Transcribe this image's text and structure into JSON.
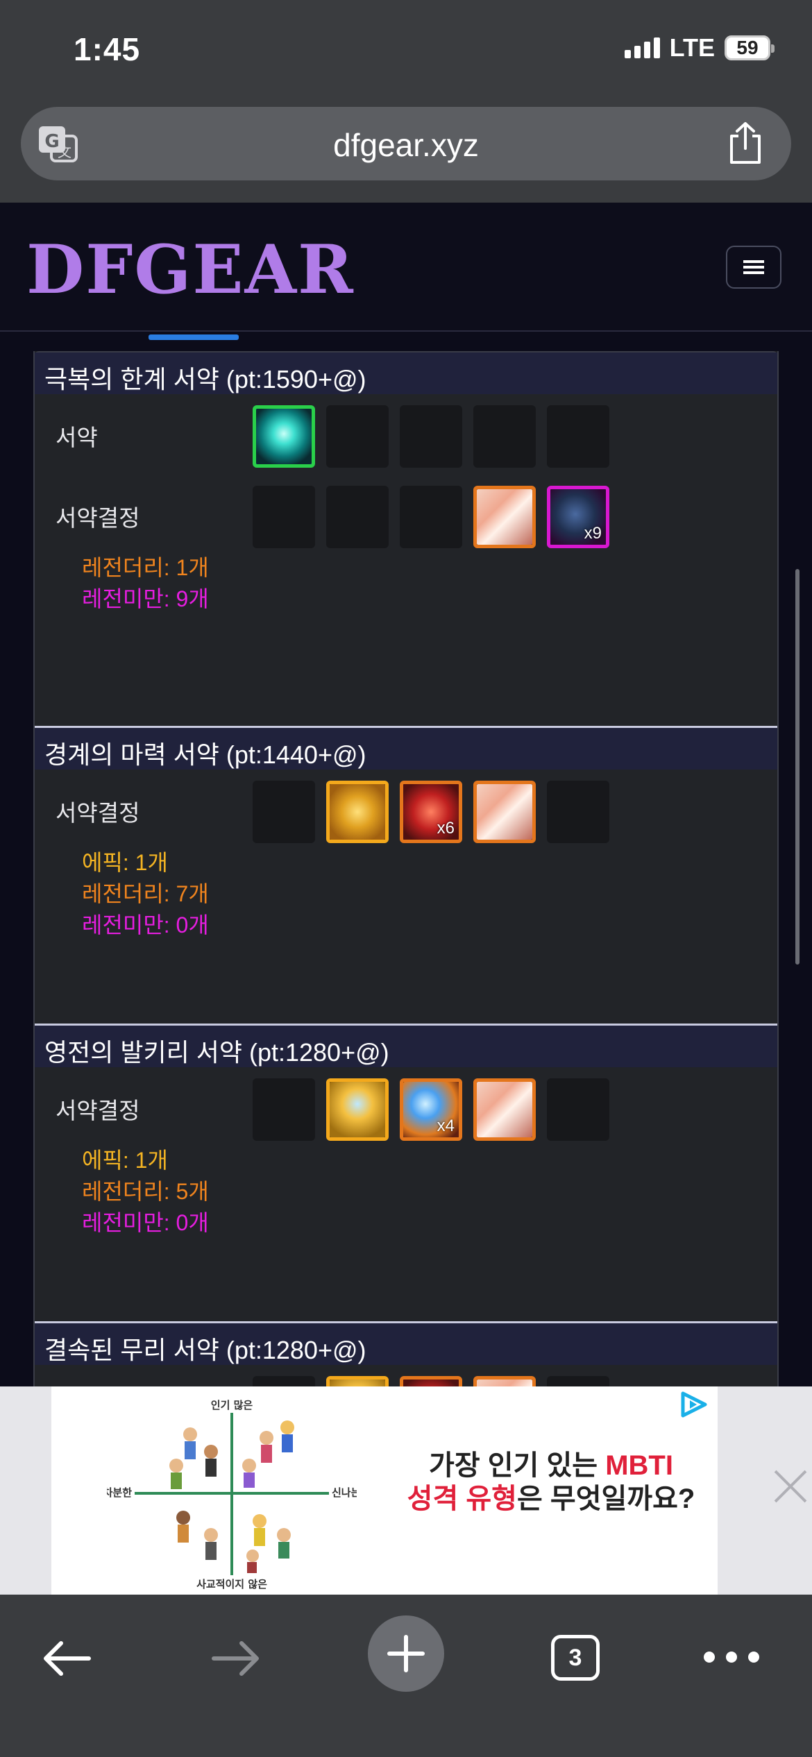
{
  "status": {
    "time": "1:45",
    "network": "LTE",
    "battery": "59"
  },
  "browser": {
    "url": "dfgear.xyz",
    "tab_count": "3"
  },
  "site": {
    "logo": "DFGEAR",
    "menu_icon": "hamburger-icon"
  },
  "colors": {
    "epic": "#f4b423",
    "legendary": "#f0841e",
    "sub_legendary": "#e61ee0",
    "title_bar": "#20223c",
    "accent": "#2a7de1"
  },
  "sections": [
    {
      "title": "극복의 한계 서약 (pt:1590+@)",
      "rows": [
        {
          "label": "서약",
          "slots": [
            {
              "type": "green",
              "icon": "cyan-orb-icon"
            },
            {
              "type": "empty"
            },
            {
              "type": "empty"
            },
            {
              "type": "empty"
            },
            {
              "type": "empty"
            }
          ]
        },
        {
          "label": "서약결정",
          "slots": [
            {
              "type": "empty"
            },
            {
              "type": "empty"
            },
            {
              "type": "empty"
            },
            {
              "type": "leg",
              "icon": "crystal-icon"
            },
            {
              "type": "sub",
              "icon": "dark-stone-icon",
              "count": "x9"
            }
          ]
        }
      ],
      "stats": [
        {
          "cls": "c-leg",
          "text": "레전더리: 1개"
        },
        {
          "cls": "c-sub",
          "text": "레전미만: 9개"
        }
      ]
    },
    {
      "title": "경계의 마력 서약 (pt:1440+@)",
      "rows": [
        {
          "label": "서약결정",
          "slots": [
            {
              "type": "empty"
            },
            {
              "type": "epic",
              "icon": "gold-burst-icon"
            },
            {
              "type": "leg",
              "icon": "red-spark-icon",
              "count": "x6"
            },
            {
              "type": "leg",
              "icon": "crystal-icon"
            },
            {
              "type": "empty"
            }
          ]
        }
      ],
      "stats": [
        {
          "cls": "c-epic",
          "text": "에픽: 1개"
        },
        {
          "cls": "c-leg",
          "text": "레전더리: 7개"
        },
        {
          "cls": "c-sub",
          "text": "레전미만: 0개"
        }
      ]
    },
    {
      "title": "영전의 발키리 서약 (pt:1280+@)",
      "rows": [
        {
          "label": "서약결정",
          "slots": [
            {
              "type": "empty"
            },
            {
              "type": "epic",
              "icon": "gold-gem-icon"
            },
            {
              "type": "leg",
              "icon": "blue-flame-icon",
              "count": "x4"
            },
            {
              "type": "leg",
              "icon": "crystal-icon"
            },
            {
              "type": "empty"
            }
          ]
        }
      ],
      "stats": [
        {
          "cls": "c-epic",
          "text": "에픽: 1개"
        },
        {
          "cls": "c-leg",
          "text": "레전더리: 5개"
        },
        {
          "cls": "c-sub",
          "text": "레전미만: 0개"
        }
      ]
    },
    {
      "title": "결속된 무리 서약 (pt:1280+@)",
      "rows": [
        {
          "label": "",
          "slots": [
            {
              "type": "empty"
            },
            {
              "type": "epic",
              "icon": "gold-gem-icon"
            },
            {
              "type": "leg",
              "icon": "red-spark-icon"
            },
            {
              "type": "leg",
              "icon": "crystal-icon"
            },
            {
              "type": "empty"
            }
          ]
        }
      ],
      "stats": []
    }
  ],
  "ad": {
    "chart_top": "인기 많은",
    "chart_bottom": "사교적이지 않은",
    "chart_left": "차분한",
    "chart_right": "신나는",
    "headline_1a": "가장 인기 있는 ",
    "headline_1b": "MBTI",
    "headline_2a": "성격 유형",
    "headline_2b": "은 무엇일까요?"
  }
}
